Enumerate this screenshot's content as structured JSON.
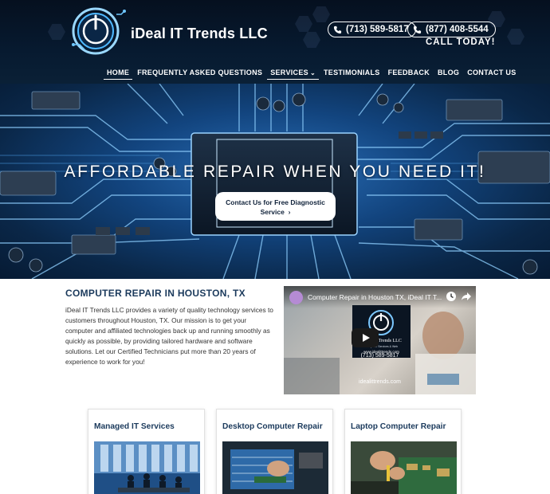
{
  "header": {
    "brand": "iDeal IT Trends LLC",
    "phone_1": "(713) 589-5817",
    "phone_2": "(877) 408-5544",
    "call_today": "CALL TODAY!"
  },
  "nav": {
    "items": [
      "HOME",
      "FREQUENTLY ASKED QUESTIONS",
      "SERVICES",
      "TESTIMONIALS",
      "FEEDBACK",
      "BLOG",
      "CONTACT US"
    ],
    "active": "HOME"
  },
  "hero": {
    "title": "AFFORDABLE REPAIR WHEN YOU NEED IT!",
    "cta_label": "Contact Us for Free Diagnostic Service"
  },
  "main": {
    "section_title": "COMPUTER REPAIR IN HOUSTON, TX",
    "intro": "iDeal IT Trends LLC provides a variety of quality technology services to customers throughout Houston, TX. Our mission is to get your computer and affiliated technologies back up and running smoothly as quickly as possible, by providing tailored hardware and software solutions. Let our Certified Technicians put more than 20 years of experience to work for you!"
  },
  "video": {
    "title": "Computer Repair in Houston TX, iDeal IT T...",
    "card_brand": "iDeal IT Trends LLC",
    "card_tagline": "Computer Services & Web",
    "card_site": "www.idealittrends.com",
    "phone": "(713) 589-5817",
    "site": "idealittrends.com"
  },
  "services": [
    {
      "title": "Managed IT Services"
    },
    {
      "title": "Desktop Computer Repair"
    },
    {
      "title": "Laptop Computer Repair"
    }
  ],
  "colors": {
    "header_bg": "#071a30",
    "accent_blue": "#1b3a5c",
    "hero_blue": "#2a6fb8"
  }
}
